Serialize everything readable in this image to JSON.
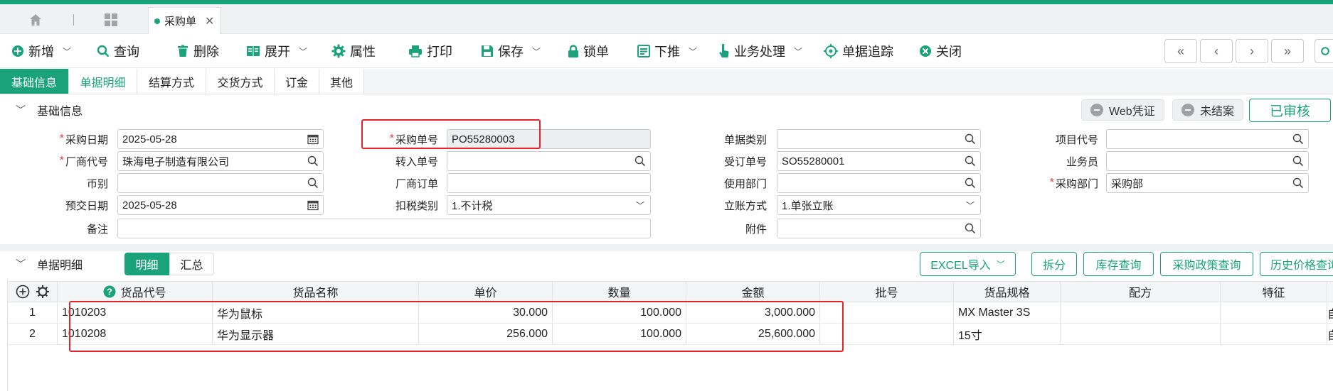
{
  "colors": {
    "accent": "#1aa37a",
    "highlight": "#e5232a"
  },
  "tabs": {
    "home_icon": "home-icon",
    "grid_icon": "grid-icon",
    "doc_tab_label": "采购单"
  },
  "toolbar": {
    "new": "新增",
    "query": "查询",
    "delete": "删除",
    "expand": "展开",
    "properties": "属性",
    "print": "打印",
    "save": "保存",
    "lock": "锁单",
    "push_down": "下推",
    "business": "业务处理",
    "trace": "单据追踪",
    "close": "关闭",
    "nav": [
      "«",
      "‹",
      "›",
      "»"
    ]
  },
  "subtabs": [
    "基础信息",
    "单据明细",
    "结算方式",
    "交货方式",
    "订金",
    "其他"
  ],
  "basic_section": {
    "title": "基础信息",
    "web_voucher": "Web凭证",
    "not_closed": "未结案",
    "approved": "已审核"
  },
  "form": {
    "purchase_date": {
      "label": "采购日期",
      "value": "2025-05-28"
    },
    "vendor_code": {
      "label": "厂商代号",
      "value": "珠海电子制造有限公司"
    },
    "currency": {
      "label": "币别",
      "value": ""
    },
    "pre_delivery_date": {
      "label": "预交日期",
      "value": "2025-05-28"
    },
    "remark": {
      "label": "备注",
      "value": ""
    },
    "purchase_no": {
      "label": "采购单号",
      "value": "PO55280003"
    },
    "transfer_no": {
      "label": "转入单号",
      "value": ""
    },
    "vendor_order": {
      "label": "厂商订单",
      "value": ""
    },
    "tax_type": {
      "label": "扣税类别",
      "value": "1.不计税"
    },
    "doc_type": {
      "label": "单据类别",
      "value": ""
    },
    "order_no": {
      "label": "受订单号",
      "value": "SO55280001"
    },
    "dept_use": {
      "label": "使用部门",
      "value": ""
    },
    "account_method": {
      "label": "立账方式",
      "value": "1.单张立账"
    },
    "attachment": {
      "label": "附件",
      "value": ""
    },
    "project_code": {
      "label": "项目代号",
      "value": ""
    },
    "salesman": {
      "label": "业务员",
      "value": ""
    },
    "purchase_dept": {
      "label": "采购部门",
      "value": "采购部"
    }
  },
  "detail_section": {
    "title": "单据明细",
    "seg_detail": "明细",
    "seg_summary": "汇总",
    "excel_import": "EXCEL导入",
    "split": "拆分",
    "stock_query": "库存查询",
    "policy_query": "采购政策查询",
    "history_price": "历史价格查询"
  },
  "table": {
    "headers": [
      "货品代号",
      "货品名称",
      "单价",
      "数量",
      "金额",
      "批号",
      "货品规格",
      "配方",
      "特征"
    ],
    "rows": [
      {
        "no": "1",
        "code": "1010203",
        "name": "华为鼠标",
        "price": "30.000",
        "qty": "100.000",
        "amount": "3,000.000",
        "batch": "",
        "spec": "MX Master 3S",
        "formula": "",
        "feature": "",
        "extra": "自"
      },
      {
        "no": "2",
        "code": "1010208",
        "name": "华为显示器",
        "price": "256.000",
        "qty": "100.000",
        "amount": "25,600.000",
        "batch": "",
        "spec": "15寸",
        "formula": "",
        "feature": "",
        "extra": "自"
      }
    ]
  }
}
